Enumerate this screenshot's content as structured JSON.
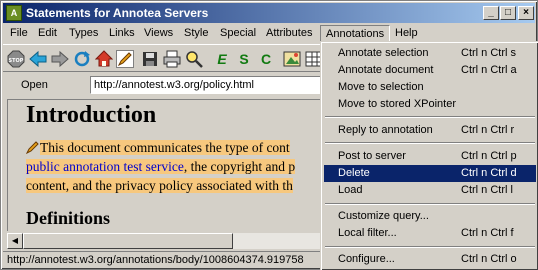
{
  "window": {
    "title": "Statements for Annotea Servers",
    "controls": [
      "_",
      "□",
      "×"
    ]
  },
  "menubar": [
    "File",
    "Edit",
    "Types",
    "Links",
    "Views",
    "Style",
    "Special",
    "Attributes",
    "Annotations",
    "Help"
  ],
  "toolbar": {
    "icons": [
      "stop-icon",
      "back-icon",
      "forward-icon",
      "reload-icon",
      "home-icon",
      "edit-pencil-icon",
      "save-icon",
      "print-icon",
      "find-icon",
      "emphasis-icon",
      "strong-icon",
      "code-icon",
      "image-icon",
      "table-icon"
    ],
    "letters": {
      "emphasis": "E",
      "strong": "S",
      "code": "C"
    }
  },
  "address": {
    "label": "Open",
    "value": "http://annotest.w3.org/policy.html"
  },
  "document": {
    "heading": "Introduction",
    "paragraph_lines": [
      "This document communicates the type of cont",
      "public annotation test service",
      ", the copyright and p",
      "content, and the privacy policy associated with th"
    ],
    "subheading": "Definitions"
  },
  "status_url": "http://annotest.w3.org/annotations/body/1008604374.919758",
  "annotations_menu": {
    "groups": [
      [
        {
          "label": "Annotate selection",
          "shortcut": "Ctrl n Ctrl s"
        },
        {
          "label": "Annotate document",
          "shortcut": "Ctrl n Ctrl a"
        },
        {
          "label": "Move to selection",
          "shortcut": ""
        },
        {
          "label": "Move to stored XPointer",
          "shortcut": ""
        }
      ],
      [
        {
          "label": "Reply to annotation",
          "shortcut": "Ctrl n Ctrl r"
        }
      ],
      [
        {
          "label": "Post to server",
          "shortcut": "Ctrl n Ctrl p"
        },
        {
          "label": "Delete",
          "shortcut": "Ctrl n Ctrl d"
        },
        {
          "label": "Load",
          "shortcut": "Ctrl n Ctrl l"
        }
      ],
      [
        {
          "label": "Customize query...",
          "shortcut": ""
        },
        {
          "label": "Local filter...",
          "shortcut": "Ctrl n Ctrl f"
        }
      ],
      [
        {
          "label": "Configure...",
          "shortcut": "Ctrl n Ctrl o"
        }
      ]
    ],
    "highlighted": "Delete"
  },
  "colors": {
    "title_gradient_start": "#0a246a",
    "title_gradient_end": "#a6caf0",
    "selection": "#0a246a",
    "annotation_highlight": "#f7c87e",
    "link": "#0000cc"
  }
}
